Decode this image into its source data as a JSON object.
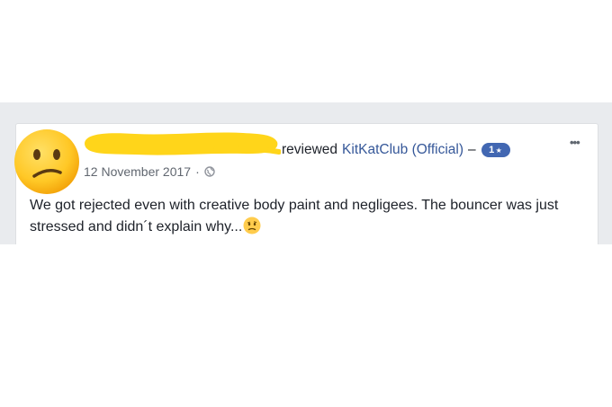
{
  "post": {
    "reviewer_suffix": "reviewed",
    "page_name": "KitKatClub (Official)",
    "dash": "–",
    "rating_value": "1",
    "rating_star": "★",
    "more": "•••",
    "date": "12 November 2017",
    "separator": "·",
    "privacy_icon": "globe-icon",
    "text": "We got rejected even with creative body paint and negligees. The bouncer was just stressed and didn´t explain why...",
    "text_emoji": "worried-face-emoji",
    "avatar_emoji": "confused-face-emoji",
    "redaction_color": "#ffd51a"
  },
  "colors": {
    "link": "#365899",
    "badge": "#4267b2",
    "background_band": "#e9ebee",
    "meta_text": "#616770",
    "body_text": "#1d2129"
  }
}
